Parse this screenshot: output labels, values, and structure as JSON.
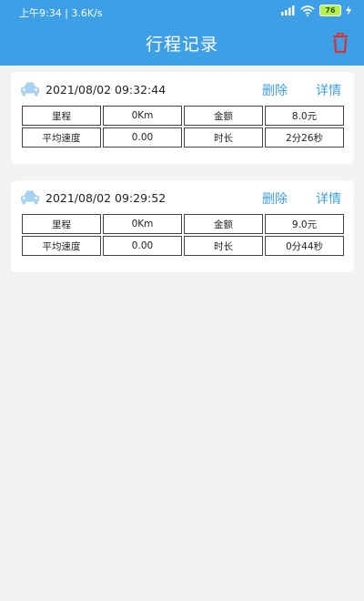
{
  "status": {
    "time": "上午9:34 | 3.6K/s",
    "battery": "76"
  },
  "header": {
    "title": "行程记录"
  },
  "trips": [
    {
      "datetime": "2021/08/02  09:32:44",
      "delete_label": "删除",
      "detail_label": "详情",
      "rows": [
        [
          "里程",
          "0Km",
          "金额",
          "8.0元"
        ],
        [
          "平均速度",
          "0.00",
          "时长",
          "2分26秒"
        ]
      ]
    },
    {
      "datetime": "2021/08/02  09:29:52",
      "delete_label": "删除",
      "detail_label": "详情",
      "rows": [
        [
          "里程",
          "0Km",
          "金额",
          "9.0元"
        ],
        [
          "平均速度",
          "0.00",
          "时长",
          "0分44秒"
        ]
      ]
    }
  ],
  "colors": {
    "header": "#3d9fe6",
    "trash": "#d9322e",
    "link": "#3d9fe6"
  },
  "icons": [
    "signal-icon",
    "wifi-icon",
    "battery-icon",
    "trash-icon",
    "taxi-icon"
  ]
}
